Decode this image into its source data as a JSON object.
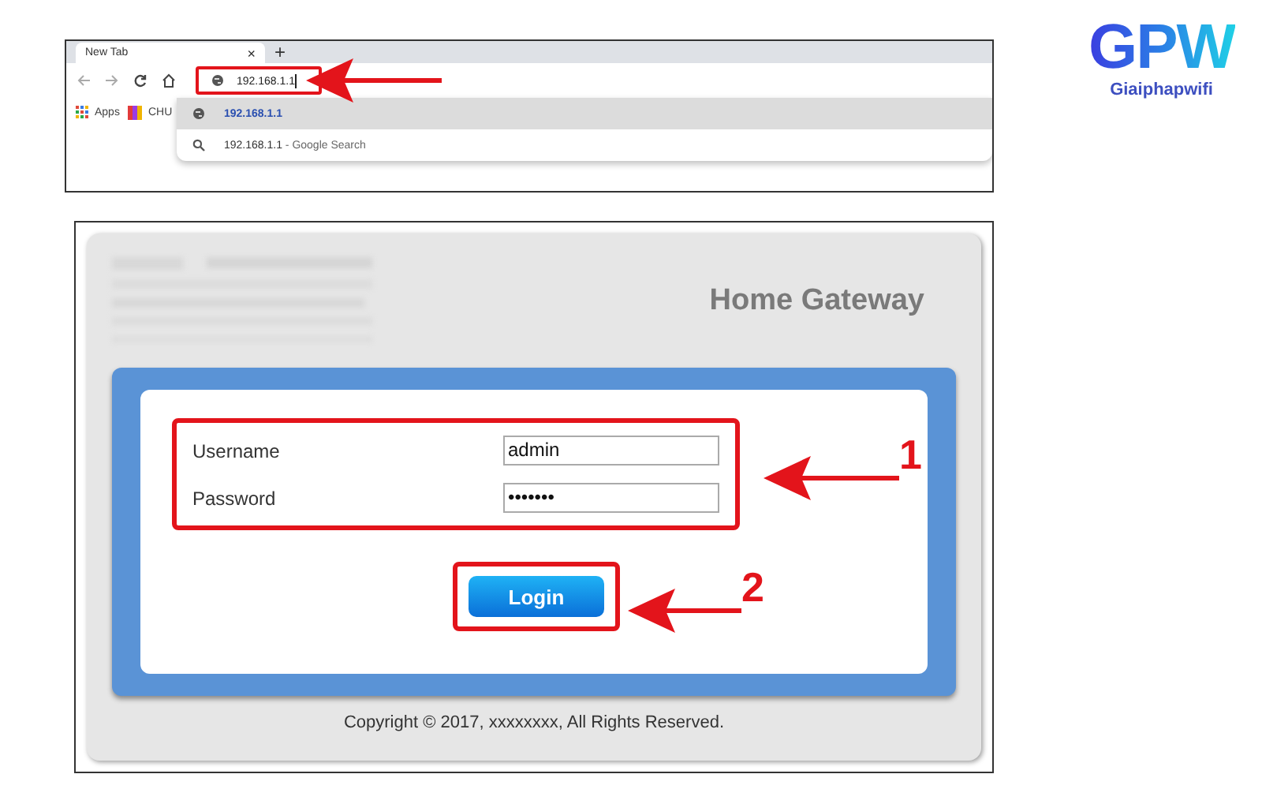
{
  "browser": {
    "tab": {
      "title": "New Tab",
      "close": "×"
    },
    "new_tab": "+",
    "address": {
      "value": "192.168.1.1"
    },
    "bookmarks": [
      {
        "label": "Apps"
      },
      {
        "label": "CHU"
      }
    ],
    "suggestions": [
      {
        "kind": "url",
        "text": "192.168.1.1",
        "selected": true
      },
      {
        "kind": "search",
        "text": "192.168.1.1",
        "suffix": " - Google Search",
        "selected": false
      }
    ]
  },
  "logo": {
    "mark": "GPW",
    "name": "Giaiphapwifi"
  },
  "gateway": {
    "title": "Home Gateway",
    "fields": [
      {
        "label": "Username",
        "value": "admin"
      },
      {
        "label": "Password",
        "value": "•••••••"
      }
    ],
    "login": "Login",
    "copyright": "Copyright © 2017, xxxxxxxx, All Rights Reserved."
  },
  "annotations": [
    {
      "number": "1"
    },
    {
      "number": "2"
    }
  ]
}
